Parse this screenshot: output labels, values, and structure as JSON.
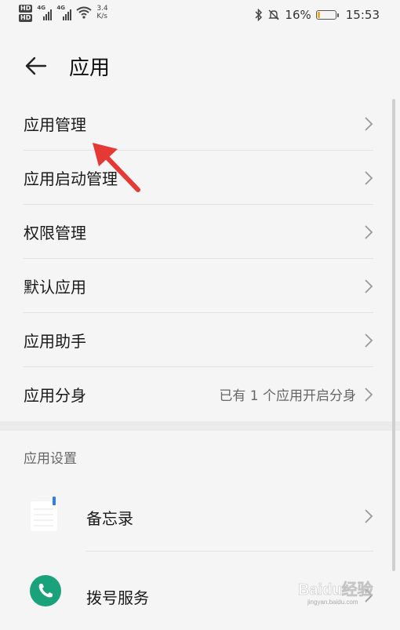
{
  "status_bar": {
    "hd1": "HD",
    "hd2": "HD",
    "net1": "4G",
    "net2": "4G",
    "speed_value": "3.4",
    "speed_unit": "K/s",
    "battery_percent_text": "16%",
    "battery_level": 0.16,
    "time": "15:53"
  },
  "header": {
    "title": "应用"
  },
  "menu": {
    "items": [
      {
        "label": "应用管理",
        "value": ""
      },
      {
        "label": "应用启动管理",
        "value": ""
      },
      {
        "label": "权限管理",
        "value": ""
      },
      {
        "label": "默认应用",
        "value": ""
      },
      {
        "label": "应用助手",
        "value": ""
      },
      {
        "label": "应用分身",
        "value": "已有 1 个应用开启分身"
      }
    ]
  },
  "settings": {
    "section_title": "应用设置",
    "apps": [
      {
        "label": "备忘录",
        "icon": "memo-icon"
      },
      {
        "label": "拨号服务",
        "icon": "phone-icon"
      }
    ]
  },
  "colors": {
    "background": "#f5f5f5",
    "battery": "#f5a623",
    "dial_icon": "#1aa37a",
    "memo_accent": "#2f7bf6",
    "annotation": "#e53935"
  },
  "watermark": {
    "text": "Baidu经验",
    "sub": "jingyan.baidu.com"
  }
}
